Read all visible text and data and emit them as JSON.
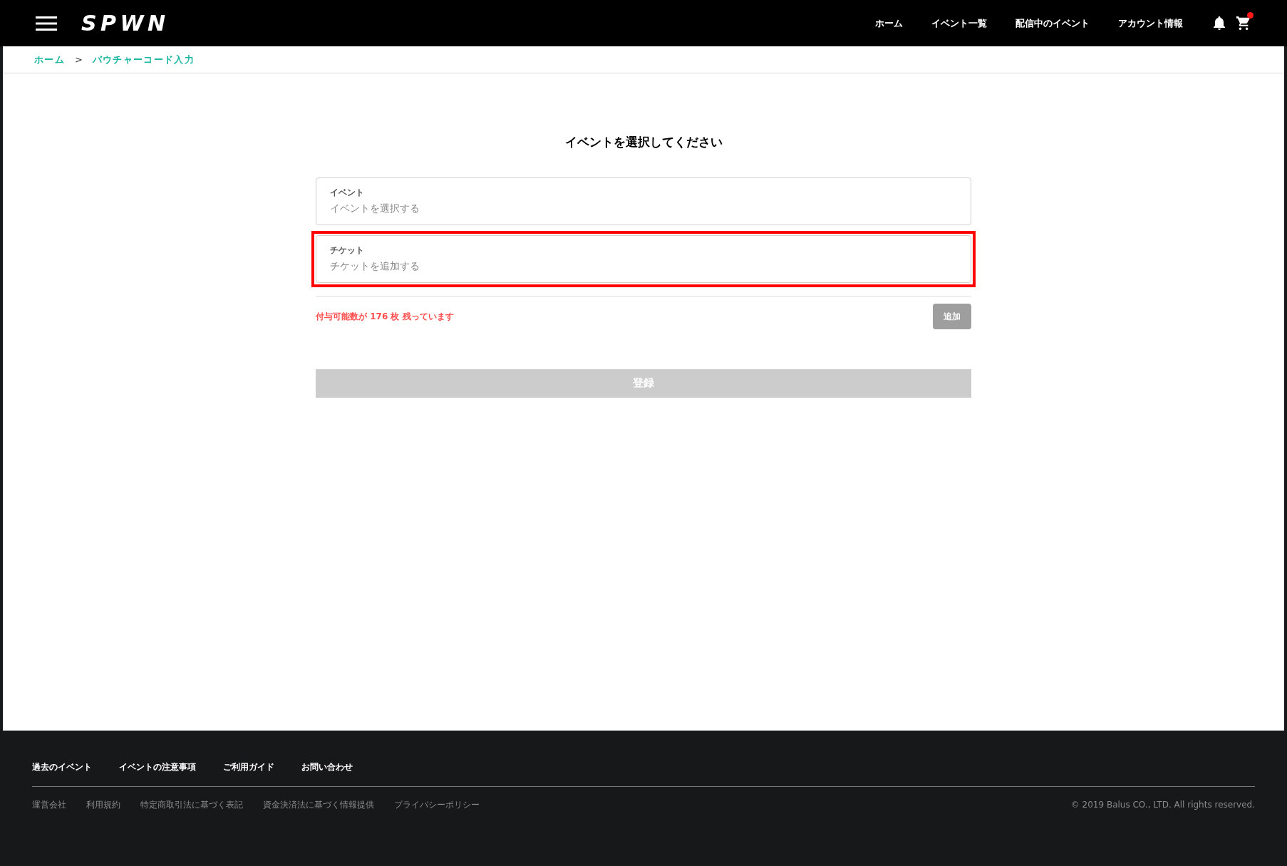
{
  "header": {
    "logo": "SPWN",
    "nav": [
      "ホーム",
      "イベント一覧",
      "配信中のイベント",
      "アカウント情報"
    ],
    "cart_badge": true
  },
  "breadcrumb": [
    {
      "label": "ホーム",
      "link": true
    },
    {
      "label": ">",
      "link": false
    },
    {
      "label": "バウチャーコード入力",
      "link": true
    }
  ],
  "title": "イベントを選択してください",
  "fields": [
    {
      "label": "イベント",
      "placeholder": "イベントを選択する",
      "highlighted": false
    },
    {
      "label": "チケット",
      "placeholder": "チケットを追加する",
      "highlighted": true
    }
  ],
  "remaining": "付与可能数が 176 枚 残っています",
  "add_button": {
    "label": "追加",
    "disabled": true
  },
  "register_button": {
    "label": "登録",
    "disabled": true
  },
  "footer": {
    "links": [
      "過去のイベント",
      "イベントの注意事項",
      "ご利用ガイド",
      "お問い合わせ"
    ],
    "legal": [
      "運営会社",
      "利用規約",
      "特定商取引法に基づく表記",
      "資金決済法に基づく情報提供",
      "プライバシーポリシー"
    ],
    "copyright": "© 2019 Balus CO., LTD. All rights reserved."
  }
}
